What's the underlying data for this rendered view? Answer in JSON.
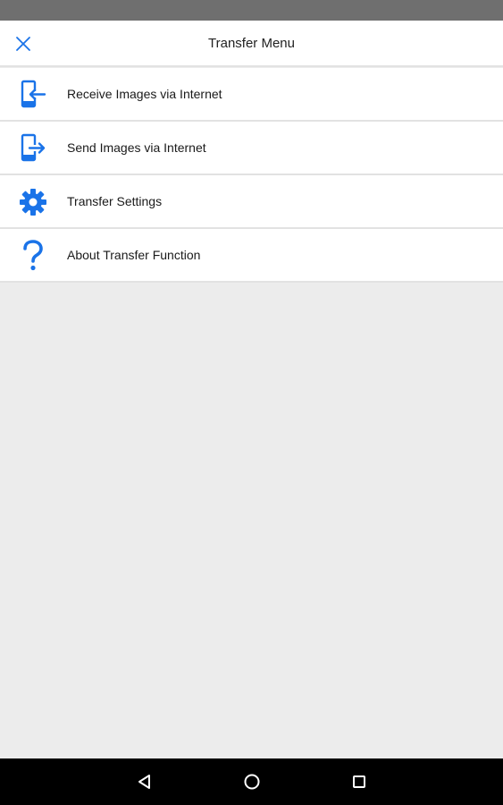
{
  "header": {
    "title": "Transfer Menu",
    "close_icon": "close-icon"
  },
  "menu": {
    "items": [
      {
        "label": "Receive Images via Internet",
        "icon": "receive-images-icon"
      },
      {
        "label": "Send Images via Internet",
        "icon": "send-images-icon"
      },
      {
        "label": "Transfer Settings",
        "icon": "gear-icon"
      },
      {
        "label": "About Transfer Function",
        "icon": "question-mark-icon"
      }
    ]
  },
  "navigation": {
    "back_icon": "back-triangle-icon",
    "home_icon": "home-circle-icon",
    "recents_icon": "recents-square-icon"
  },
  "colors": {
    "accent": "#1a73e8",
    "status_bar": "#6f6f6f",
    "background": "#ececec",
    "nav_bar": "#000000"
  }
}
